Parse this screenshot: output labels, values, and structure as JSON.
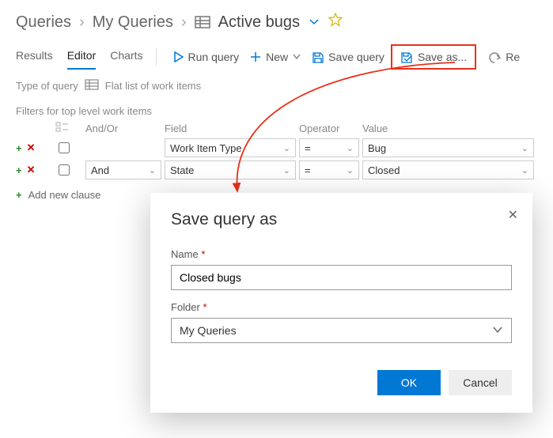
{
  "breadcrumb": {
    "root": "Queries",
    "mid": "My Queries",
    "leaf": "Active bugs"
  },
  "tabs": {
    "results": "Results",
    "editor": "Editor",
    "charts": "Charts"
  },
  "actions": {
    "run": "Run query",
    "new": "New",
    "save": "Save query",
    "saveas": "Save as...",
    "undo": "Re"
  },
  "subrow": {
    "type_label": "Type of query",
    "flat": "Flat list of work items"
  },
  "filters": {
    "title": "Filters for top level work items",
    "head": {
      "andor": "And/Or",
      "field": "Field",
      "operator": "Operator",
      "value": "Value"
    },
    "rows": [
      {
        "andor": "",
        "field": "Work Item Type",
        "op": "=",
        "value": "Bug"
      },
      {
        "andor": "And",
        "field": "State",
        "op": "=",
        "value": "Closed"
      }
    ],
    "add": "Add new clause"
  },
  "dialog": {
    "title": "Save query as",
    "name_label": "Name",
    "name_value": "Closed bugs",
    "folder_label": "Folder",
    "folder_value": "My Queries",
    "ok": "OK",
    "cancel": "Cancel"
  }
}
